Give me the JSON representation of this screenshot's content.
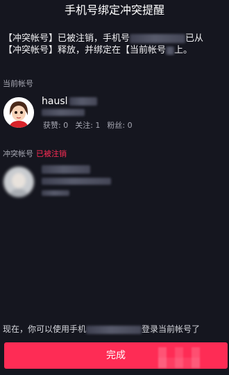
{
  "header": {
    "title": "手机号绑定冲突提醒"
  },
  "notice": {
    "line1_start": "【冲突帐号】已被注销，手机号",
    "line1_end": "已从",
    "line2_start": "【冲突帐号】释放，并绑定在【当前帐号",
    "line2_end": "上。"
  },
  "current_account": {
    "section_label": "当前帐号",
    "username_visible": "hausl",
    "stats": {
      "likes": "获赞: 0",
      "following": "关注: 1",
      "fans": "粉丝: 0"
    }
  },
  "conflict_account": {
    "section_label": "冲突帐号",
    "status": "已被注销"
  },
  "footer": {
    "text_start": "现在，你可以使用手机",
    "text_end": "登录当前帐号了"
  },
  "done_button": {
    "label": "完成"
  },
  "colors": {
    "background": "#15161f",
    "accent": "#fe2c55",
    "muted_text": "#a7a8b3"
  }
}
